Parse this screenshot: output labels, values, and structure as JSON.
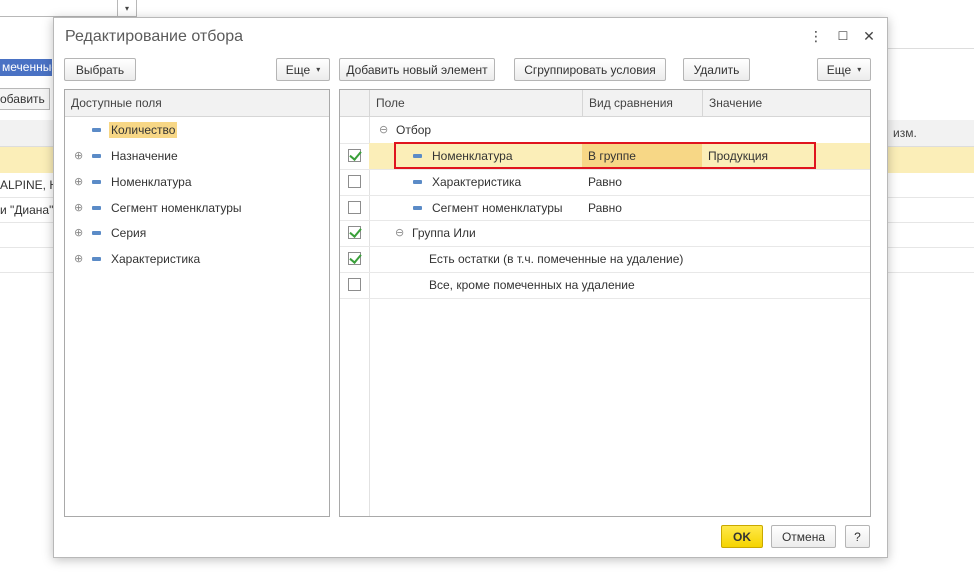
{
  "background": {
    "chip_text": "меченные",
    "button_text": "обавить",
    "right_header": "изм.",
    "rows_left": [
      "",
      "ALPINE, H",
      "и \"Диана\"",
      "",
      ""
    ]
  },
  "dialog": {
    "title": "Редактирование отбора",
    "controls": {
      "more": "⋮",
      "maximize": "☐",
      "close": "✕"
    },
    "toolbar": {
      "select": "Выбрать",
      "more_left": "Еще",
      "add_element": "Добавить новый элемент",
      "group_conditions": "Сгруппировать условия",
      "delete": "Удалить",
      "more_right": "Еще"
    },
    "left_panel": {
      "header": "Доступные поля",
      "items": [
        {
          "label": "Количество",
          "expandable": false,
          "selected": true
        },
        {
          "label": "Назначение",
          "expandable": true,
          "selected": false
        },
        {
          "label": "Номенклатура",
          "expandable": true,
          "selected": false
        },
        {
          "label": "Сегмент номенклатуры",
          "expandable": true,
          "selected": false
        },
        {
          "label": "Серия",
          "expandable": true,
          "selected": false
        },
        {
          "label": "Характеристика",
          "expandable": true,
          "selected": false
        }
      ]
    },
    "right_panel": {
      "columns": {
        "field": "Поле",
        "comparison": "Вид сравнения",
        "value": "Значение"
      },
      "rows": [
        {
          "type": "root",
          "label": "Отбор",
          "checked": null,
          "comparison": "",
          "value": ""
        },
        {
          "type": "field",
          "label": "Номенклатура",
          "checked": true,
          "comparison": "В группе",
          "value": "Продукция",
          "selected": true
        },
        {
          "type": "field",
          "label": "Характеристика",
          "checked": false,
          "comparison": "Равно",
          "value": ""
        },
        {
          "type": "field",
          "label": "Сегмент номенклатуры",
          "checked": false,
          "comparison": "Равно",
          "value": ""
        },
        {
          "type": "group",
          "label": "Группа Или",
          "checked": true,
          "comparison": "",
          "value": ""
        },
        {
          "type": "preset",
          "label": "Есть остатки (в т.ч. помеченные на удаление)",
          "checked": true,
          "comparison": "",
          "value": ""
        },
        {
          "type": "preset",
          "label": "Все, кроме помеченных на удаление",
          "checked": false,
          "comparison": "",
          "value": ""
        }
      ]
    },
    "footer": {
      "ok": "OK",
      "cancel": "Отмена",
      "help": "?"
    },
    "colors": {
      "selection": "#fbeeb8",
      "cell_highlight": "#f7d786",
      "annotation": "#e0141e",
      "ok_button": "#f5d400",
      "checkmark": "#3aa03a"
    }
  }
}
